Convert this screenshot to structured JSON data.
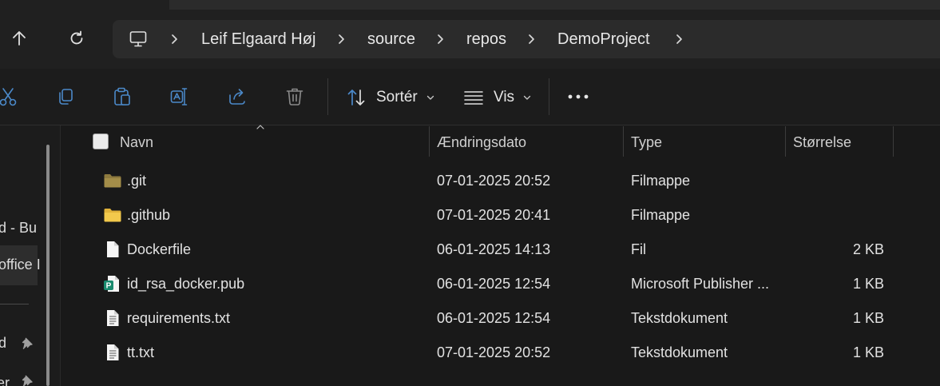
{
  "breadcrumb": {
    "items": [
      "Leif Elgaard Høj",
      "source",
      "repos",
      "DemoProject"
    ]
  },
  "toolbar": {
    "sort_label": "Sortér",
    "view_label": "Vis"
  },
  "sidebar": {
    "item_a": "d - Bu",
    "item_b": "office I",
    "item_c": "d",
    "item_d": "er"
  },
  "columns": {
    "name": "Navn",
    "date": "Ændringsdato",
    "type": "Type",
    "size": "Størrelse"
  },
  "files": [
    {
      "name": ".git",
      "date": "07-01-2025 20:52",
      "type": "Filmappe",
      "size": "",
      "icon": "folder-dim-icon"
    },
    {
      "name": ".github",
      "date": "07-01-2025 20:41",
      "type": "Filmappe",
      "size": "",
      "icon": "folder-icon"
    },
    {
      "name": "Dockerfile",
      "date": "06-01-2025 14:13",
      "type": "Fil",
      "size": "2 KB",
      "icon": "file-icon"
    },
    {
      "name": "id_rsa_docker.pub",
      "date": "06-01-2025 12:54",
      "type": "Microsoft Publisher ...",
      "size": "1 KB",
      "icon": "publisher-icon"
    },
    {
      "name": "requirements.txt",
      "date": "06-01-2025 12:54",
      "type": "Tekstdokument",
      "size": "1 KB",
      "icon": "text-file-icon"
    },
    {
      "name": "tt.txt",
      "date": "07-01-2025 20:52",
      "type": "Tekstdokument",
      "size": "1 KB",
      "icon": "text-file-icon"
    }
  ],
  "colors": {
    "folder": "#f2c94c",
    "folder_dim": "#8e7a3e",
    "publisher": "#1a8a6e"
  }
}
